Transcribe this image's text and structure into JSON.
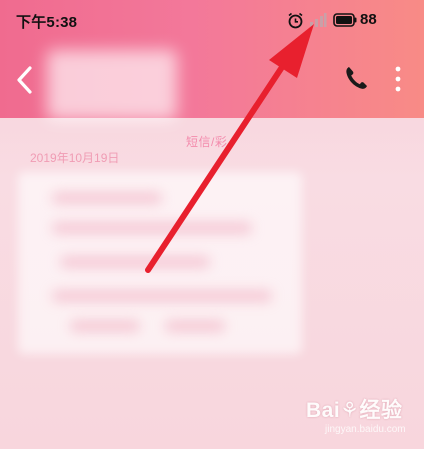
{
  "status_bar": {
    "time": "下午5:38",
    "battery": "88",
    "icons": [
      "alarm-icon",
      "signal-icon",
      "battery-icon"
    ]
  },
  "header": {
    "icons": [
      "back-arrow-icon",
      "phone-icon",
      "more-vertical-icon"
    ]
  },
  "conversation": {
    "message_type": "短信/彩",
    "date": "2019年10月19日"
  },
  "watermark": {
    "brand": "Bai⚘经验",
    "url": "jingyan.baidu.com"
  },
  "colors": {
    "header_start": "#f06b8f",
    "header_end": "#f88b86",
    "accent_arrow": "#e8202e",
    "date_text": "#f09cb4"
  }
}
